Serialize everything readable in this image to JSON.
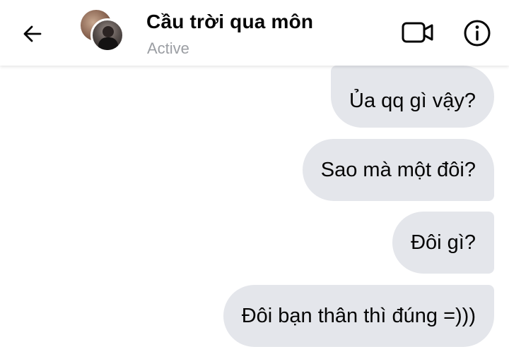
{
  "header": {
    "contact_name": "Cầu trời qua môn",
    "status": "Active",
    "icons": {
      "back": "back-arrow-icon",
      "video": "video-call-icon",
      "info": "info-icon"
    }
  },
  "messages": [
    {
      "text": "Ủa qq gì vậy?",
      "sender": "me"
    },
    {
      "text": "Sao mà một đôi?",
      "sender": "me"
    },
    {
      "text": "Đôi gì?",
      "sender": "me"
    },
    {
      "text": "Đôi bạn thân thì đúng =)))",
      "sender": "me"
    }
  ],
  "colors": {
    "bubble_background": "#e4e6eb",
    "text": "#050505",
    "status_text": "#9b9ea3"
  }
}
